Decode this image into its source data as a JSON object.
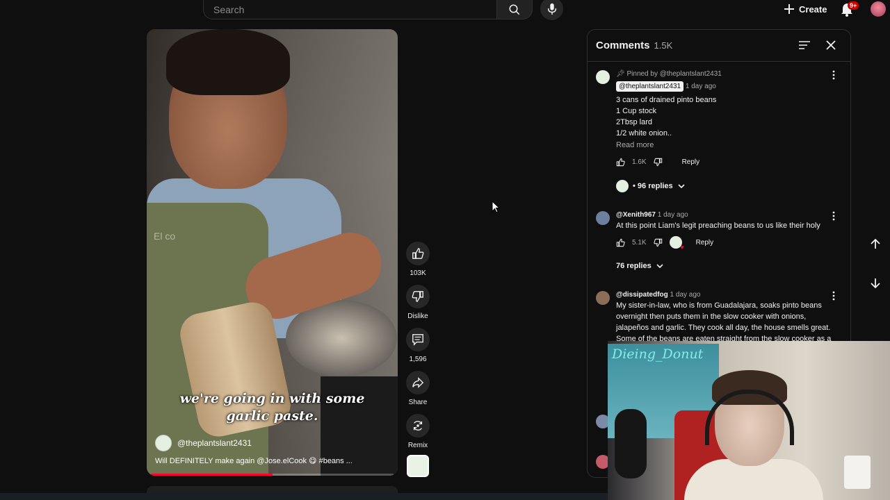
{
  "topbar": {
    "search_placeholder": "Search",
    "create_label": "Create",
    "notif_badge": "9+"
  },
  "video": {
    "channel": "@theplantslant2431",
    "caption_line1": "we're going in with some",
    "caption_line2": "garlic paste.",
    "apron_text": "El co",
    "description": "Will DEFINITELY make again @Jose.elCook 😋 #beans ...",
    "progress": 0.5
  },
  "actions": {
    "like_count": "103K",
    "dislike_label": "Dislike",
    "comment_count": "1,596",
    "share_label": "Share",
    "remix_label": "Remix"
  },
  "comments": {
    "title": "Comments",
    "count": "1.5K",
    "pinned": {
      "pinned_by": "Pinned by @theplantslant2431",
      "user": "@theplantslant2431",
      "time": "1 day ago",
      "lines": [
        "3 cans of drained pinto beans",
        "1 Cup stock",
        "2Tbsp lard",
        "1/2 white onion.."
      ],
      "read_more": "Read more",
      "likes": "1.6K",
      "reply": "Reply",
      "replies": "• 96 replies"
    },
    "c2": {
      "user": "@Xenith967",
      "time": "1 day ago",
      "text": "At this point Liam's legit preaching beans to us like their holy",
      "likes": "5.1K",
      "reply": "Reply",
      "replies": "76 replies"
    },
    "c3": {
      "user": "@dissipatedfog",
      "time": "1 day ago",
      "lines": [
        "My sister-in-law, who is from Guadalajara, soaks pinto beans",
        "overnight then puts them in the slow cooker with onions,",
        "jalapeños and garlic. They cook all day, the house smells great.",
        "Some of the beans are eaten straight from the slow cooker as a"
      ]
    }
  },
  "webcam": {
    "name": "Dieing_Donut"
  },
  "colors": {
    "accent_red": "#ff0033",
    "panel_bg": "#0f0f0f",
    "webcam_name": "#7ff0e6"
  }
}
